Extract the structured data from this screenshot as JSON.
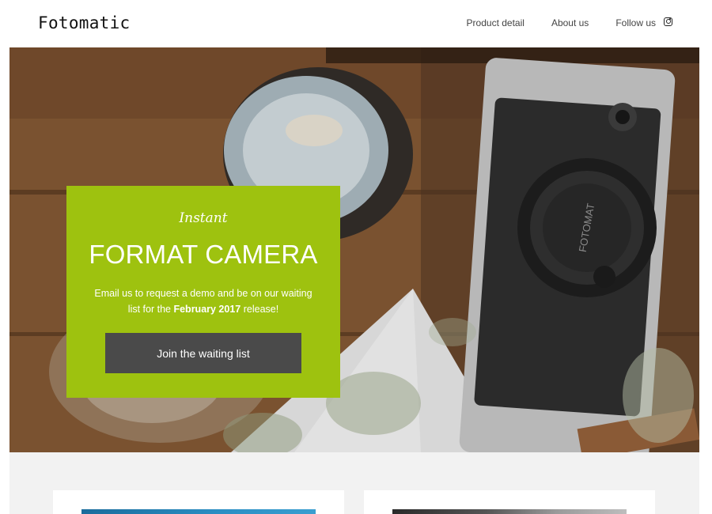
{
  "header": {
    "logo": "Fotomatic",
    "nav": [
      "Product detail",
      "About us"
    ],
    "follow_label": "Follow us",
    "follow_icon": "instagram-icon"
  },
  "hero": {
    "script_heading": "Instant",
    "title": "FORMAT CAMERA",
    "text_part1": "Email us to request a demo and be on our waiting list for the ",
    "text_bold": "February 2017",
    "text_part2": " release!",
    "button_label": "Join the waiting list",
    "camera_lens_label": "FOTOMAT",
    "accent_color": "#9ec20f",
    "button_color": "#4a4a4a"
  }
}
